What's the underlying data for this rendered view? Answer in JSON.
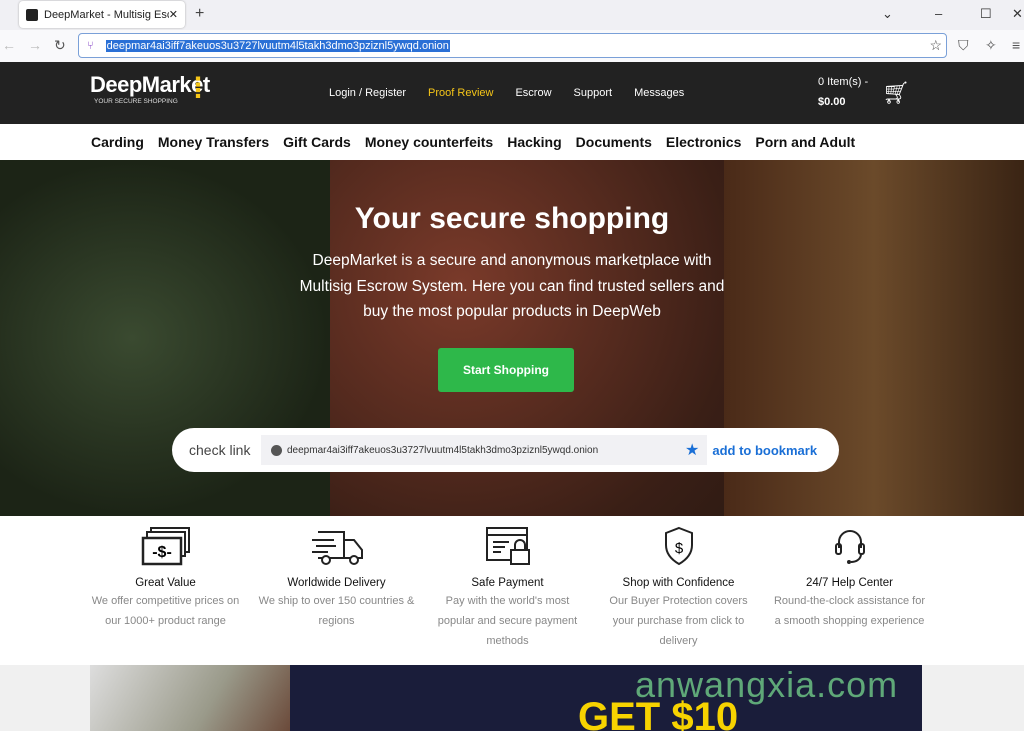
{
  "browser": {
    "tab_title": "DeepMarket - Multisig Escrow",
    "url": "deepmar4ai3iff7akeuos3u3727lvuutm4l5takh3dmo3pziznl5ywqd.onion"
  },
  "header": {
    "logo": "DeepMarket",
    "tagline": "YOUR SECURE SHOPPING",
    "menu": [
      "Login / Register",
      "Proof Review",
      "Escrow",
      "Support",
      "Messages"
    ],
    "active": "Proof Review",
    "cart_items": "0 Item(s) -",
    "cart_total": "$0.00"
  },
  "categories": [
    "Carding",
    "Money Transfers",
    "Gift Cards",
    "Money counterfeits",
    "Hacking",
    "Documents",
    "Electronics",
    "Porn and Adult"
  ],
  "hero": {
    "title": "Your secure shopping",
    "text": "DeepMarket is a secure and anonymous marketplace with Multisig Escrow System. Here you can find trusted sellers and buy the most popular products in DeepWeb",
    "button": "Start Shopping",
    "check_label": "check link",
    "check_url": "deepmar4ai3iff7akeuos3u3727lvuutm4l5takh3dmo3pziznl5ywqd.onion",
    "bookmark": "add to bookmark"
  },
  "features": [
    {
      "icon": "money-icon",
      "title": "Great Value",
      "desc": "We offer competitive prices on our 1000+ product range"
    },
    {
      "icon": "truck-icon",
      "title": "Worldwide Delivery",
      "desc": "We ship to over 150 countries & regions"
    },
    {
      "icon": "payment-lock-icon",
      "title": "Safe Payment",
      "desc": "Pay with the world's most popular and secure payment methods"
    },
    {
      "icon": "shield-dollar-icon",
      "title": "Shop with Confidence",
      "desc": "Our Buyer Protection covers your purchase from click to delivery"
    },
    {
      "icon": "headset-icon",
      "title": "24/7 Help Center",
      "desc": "Round-the-clock assistance for a smooth shopping experience"
    }
  ],
  "banner": {
    "text": "GET $10"
  },
  "watermark": "anwangxia.com",
  "colors": {
    "accent": "#f5c518",
    "button": "#2eb84a",
    "link": "#1a6fd6",
    "header": "#222222"
  }
}
